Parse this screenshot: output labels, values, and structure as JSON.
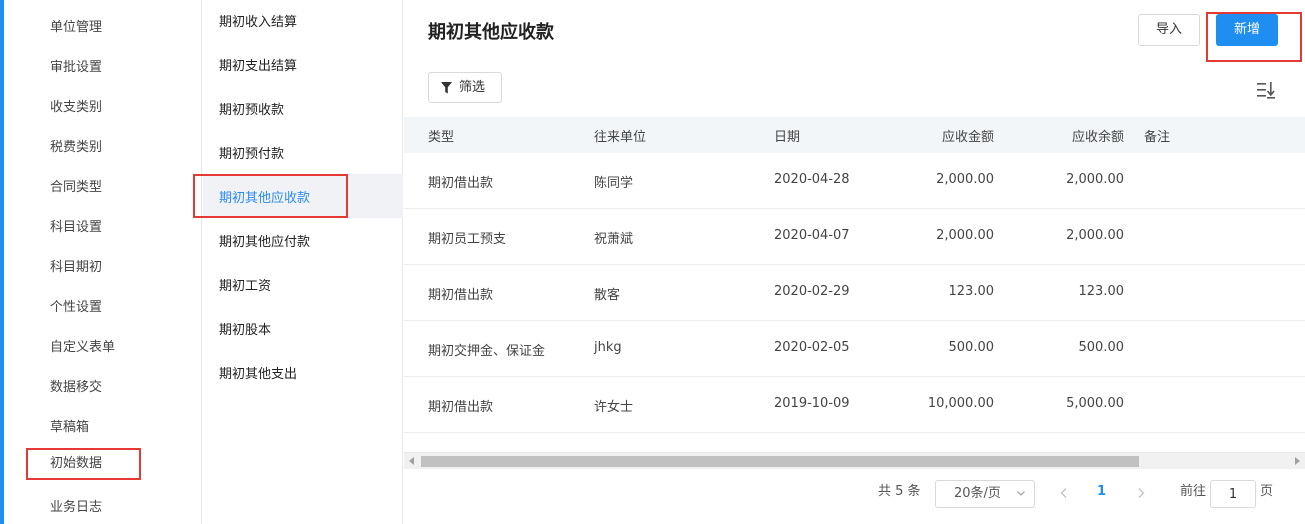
{
  "nav1": {
    "items": [
      "单位管理",
      "审批设置",
      "收支类别",
      "税费类别",
      "合同类型",
      "科目设置",
      "科目期初",
      "个性设置",
      "自定义表单",
      "数据移交",
      "草稿箱",
      "初始数据",
      "业务日志"
    ]
  },
  "nav2": {
    "items": [
      "期初收入结算",
      "期初支出结算",
      "期初预收款",
      "期初预付款",
      "期初其他应收款",
      "期初其他应付款",
      "期初工资",
      "期初股本",
      "期初其他支出"
    ]
  },
  "page": {
    "title": "期初其他应收款",
    "import_label": "导入",
    "new_label": "新增",
    "filter_label": "筛选"
  },
  "table": {
    "columns": [
      "类型",
      "往来单位",
      "日期",
      "应收金额",
      "应收余额",
      "备注"
    ],
    "rows": [
      [
        "期初借出款",
        "陈同学",
        "2020-04-28",
        "2,000.00",
        "2,000.00",
        ""
      ],
      [
        "期初员工预支",
        "祝萧斌",
        "2020-04-07",
        "2,000.00",
        "2,000.00",
        ""
      ],
      [
        "期初借出款",
        "散客",
        "2020-02-29",
        "123.00",
        "123.00",
        ""
      ],
      [
        "期初交押金、保证金",
        "jhkg",
        "2020-02-05",
        "500.00",
        "500.00",
        ""
      ],
      [
        "期初借出款",
        "许女士",
        "2019-10-09",
        "10,000.00",
        "5,000.00",
        ""
      ]
    ]
  },
  "pagination": {
    "total": "共 5 条",
    "page_size": "20条/页",
    "current_page": "1",
    "goto_prefix": "前往",
    "goto_value": "1",
    "goto_suffix": "页"
  },
  "colors": {
    "accent": "#1e8ef0",
    "highlight_box": "#e53935"
  },
  "icons": [
    "funnel-icon",
    "sort-icon",
    "chevron-down-icon",
    "chevron-left-icon",
    "chevron-right-icon"
  ]
}
